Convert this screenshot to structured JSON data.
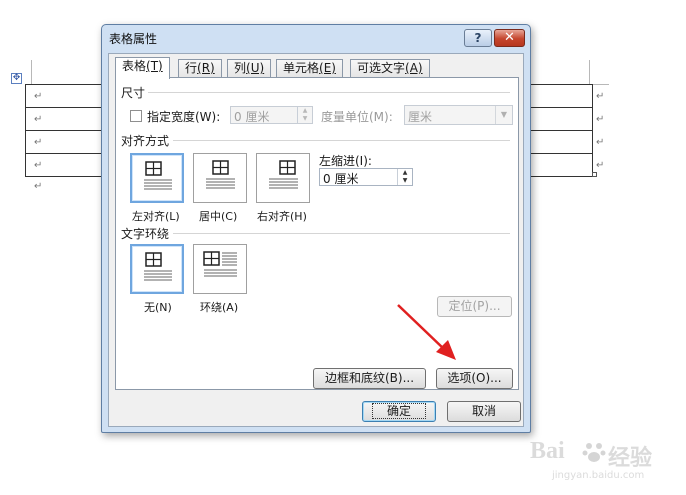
{
  "document": {
    "paragraph_mark": "↵",
    "move_handle_icon": "four-arrow-move-icon"
  },
  "dialog": {
    "title": "表格属性",
    "help_label": "?",
    "close_label": "✕",
    "tabs": [
      {
        "label": "表格",
        "key": "(T)"
      },
      {
        "label": "行",
        "key": "(R)"
      },
      {
        "label": "列",
        "key": "(U)"
      },
      {
        "label": "单元格",
        "key": "(E)"
      },
      {
        "label": "可选文字",
        "key": "(A)"
      }
    ],
    "size": {
      "title": "尺寸",
      "preferred_width_label": "指定宽度(W):",
      "preferred_width_value": "0 厘米",
      "measure_in_label": "度量单位(M):",
      "measure_in_value": "厘米"
    },
    "alignment": {
      "title": "对齐方式",
      "options": [
        "左对齐(L)",
        "居中(C)",
        "右对齐(H)"
      ],
      "selected": 0,
      "indent_label": "左缩进(I):",
      "indent_value": "0 厘米"
    },
    "wrapping": {
      "title": "文字环绕",
      "options": [
        "无(N)",
        "环绕(A)"
      ],
      "selected": 0
    },
    "buttons": {
      "positioning": "定位(P)...",
      "borders": "边框和底纹(B)...",
      "options": "选项(O)...",
      "ok": "确定",
      "cancel": "取消"
    }
  },
  "colors": {
    "accent": "#6fa6df",
    "annotation_arrow": "#e02020",
    "close_button": "#c5452d"
  },
  "watermark": {
    "brand": "Bai",
    "brand2": "经验",
    "url": "jingyan.baidu.com"
  }
}
